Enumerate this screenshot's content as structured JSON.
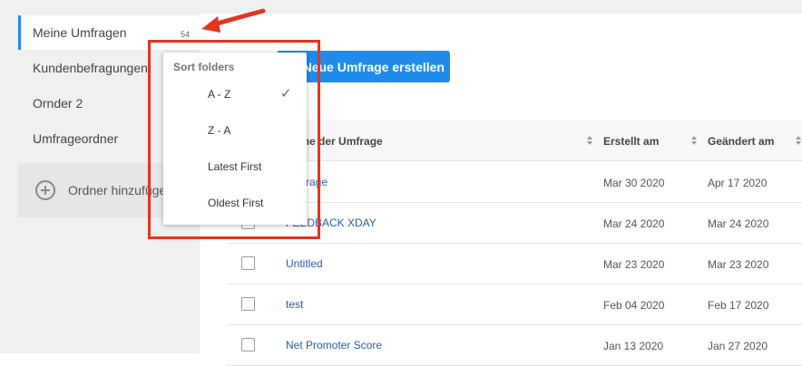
{
  "sidebar": {
    "items": [
      {
        "label": "Meine Umfragen",
        "count": "54"
      },
      {
        "label": "Kundenbefragungen"
      },
      {
        "label": "Ornder 2"
      },
      {
        "label": "Umfrageordner"
      }
    ],
    "add_folder_label": "Ordner hinzufügen"
  },
  "toolbar": {
    "create_label": "Neue Umfrage erstellen"
  },
  "table": {
    "headers": {
      "name": "Name der Umfrage",
      "created": "Erstellt am",
      "changed": "Geändert am"
    },
    "rows": [
      {
        "name": "Umfrage",
        "created": "Mar 30 2020",
        "changed": "Apr 17 2020"
      },
      {
        "name": "FEEDBACK XDAY",
        "created": "Mar 24 2020",
        "changed": "Mar 24 2020"
      },
      {
        "name": "Untitled",
        "created": "Mar 23 2020",
        "changed": "Mar 23 2020"
      },
      {
        "name": "test",
        "created": "Feb 04 2020",
        "changed": "Feb 17 2020"
      },
      {
        "name": "Net Promoter Score",
        "created": "Jan 13 2020",
        "changed": "Jan 27 2020"
      }
    ]
  },
  "sort_menu": {
    "title": "Sort folders",
    "options": [
      "A - Z",
      "Z - A",
      "Latest First",
      "Oldest First"
    ],
    "selected_index": 0,
    "check_icon": "checkmark-icon"
  },
  "colors": {
    "accent": "#1f8ceb",
    "annotation": "#e53420",
    "link": "#2a5aa8"
  }
}
